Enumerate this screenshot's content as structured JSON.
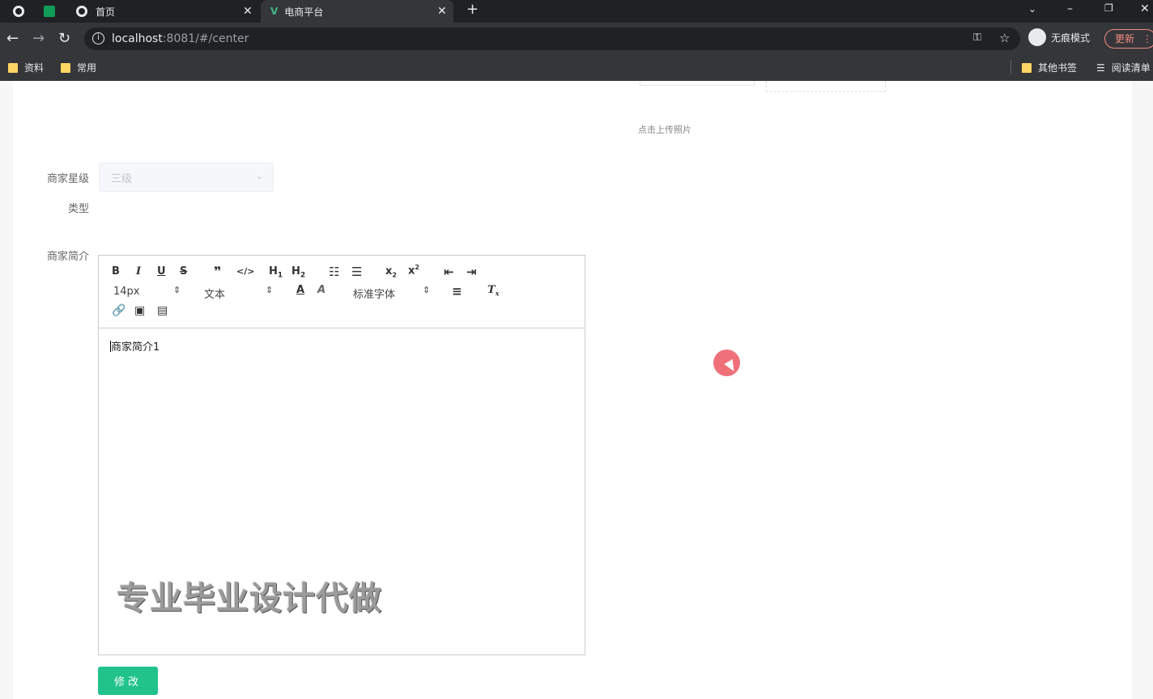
{
  "browser": {
    "tabs": [
      {
        "label": "首页"
      },
      {
        "label": "电商平台"
      }
    ],
    "url_host": "localhost",
    "url_rest": ":8081/#/center",
    "incognito_label": "无痕模式",
    "update_label": "更新",
    "bookmarks": [
      {
        "label": "资料"
      },
      {
        "label": "常用"
      },
      {
        "label": "其他书签"
      },
      {
        "label": "阅读清单"
      }
    ]
  },
  "form": {
    "upload_hint": "点击上传照片",
    "star_label": "商家星级",
    "star_value": "三级",
    "type_label": "类型",
    "intro_label": "商家简介",
    "intro_content": "商家简介1",
    "submit_label": "修改"
  },
  "editor_toolbar": {
    "font_size": "14px",
    "heading_select": "文本",
    "font_family": "标准字体"
  },
  "watermark": "专业毕业设计代做"
}
